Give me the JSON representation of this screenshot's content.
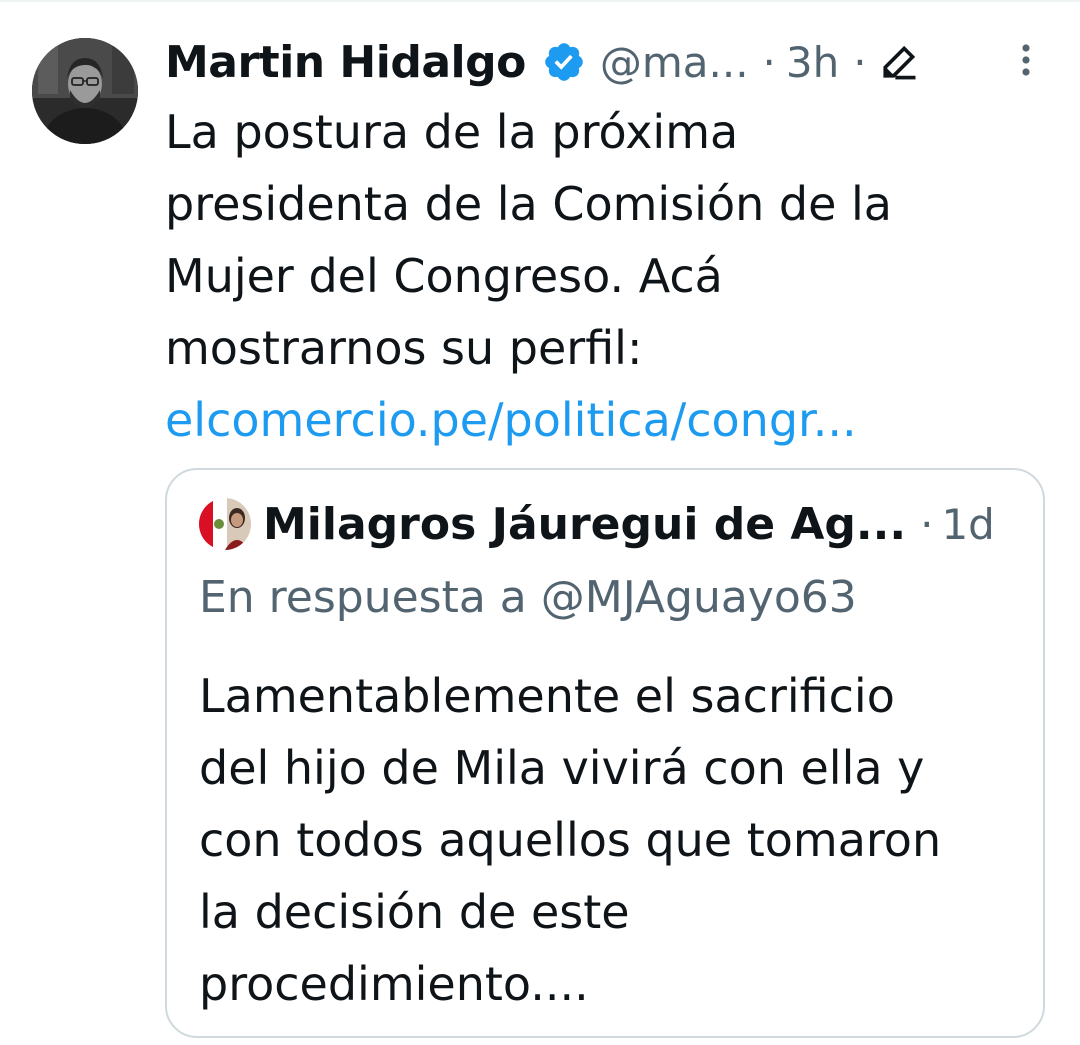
{
  "tweet": {
    "author_name": "Martin Hidalgo",
    "handle": "@ma...",
    "separator": "·",
    "time": "3h",
    "text_lines": [
      "La postura de la próxima",
      "presidenta de la Comisión de la",
      "Mujer del Congreso. Acá",
      "mostrarnos su perfil:"
    ],
    "link": "elcomercio.pe/politica/congr...",
    "icons": {
      "verified": "verified-badge-icon",
      "edited": "edit-pencil-icon",
      "more": "more-options-icon"
    }
  },
  "quote": {
    "author_name": "Milagros Jáuregui de Ag...",
    "separator": "·",
    "time": "1d",
    "reply_to": "En respuesta a @MJAguayo63",
    "text_lines": [
      "Lamentablemente el sacrificio",
      "del hijo de Mila vivirá con ella y",
      "con todos aquellos que tomaron",
      "la decisión de este",
      "procedimiento...."
    ]
  },
  "colors": {
    "text": "#0f1419",
    "secondary": "#536471",
    "link": "#1d9bf0",
    "verified": "#1d9bf0",
    "border": "#cfd9de"
  }
}
